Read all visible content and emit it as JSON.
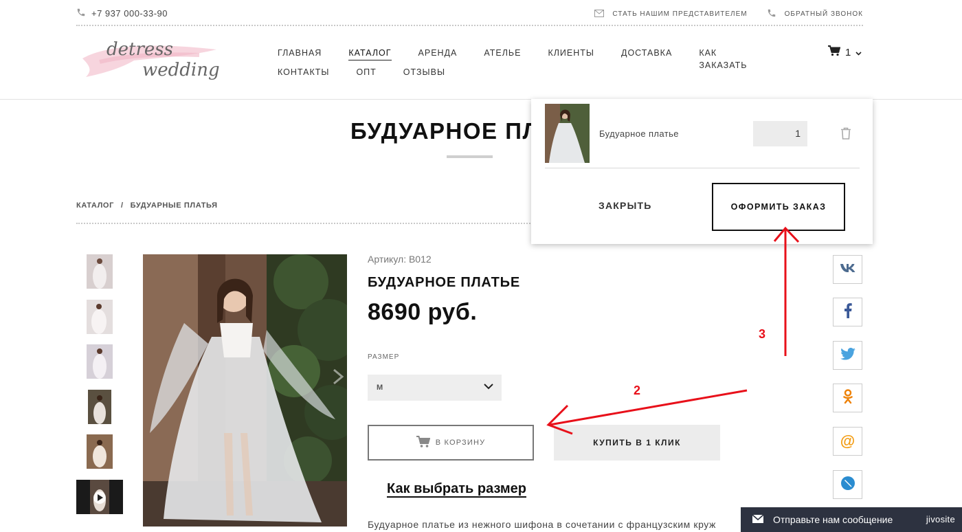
{
  "topbar": {
    "phone": "+7 937 000-33-90",
    "representative": "СТАТЬ НАШИМ ПРЕДСТАВИТЕЛЕМ",
    "callback": "ОБРАТНЫЙ ЗВОНОК"
  },
  "logo": {
    "line1": "detress",
    "line2": "wedding"
  },
  "nav": {
    "row1": [
      "ГЛАВНАЯ",
      "КАТАЛОГ",
      "АРЕНДА",
      "АТЕЛЬЕ",
      "КЛИЕНТЫ",
      "ДОСТАВКА",
      "КАК ЗАКАЗАТЬ"
    ],
    "row2": [
      "КОНТАКТЫ",
      "ОПТ",
      "ОТЗЫВЫ"
    ],
    "active": "КАТАЛОГ"
  },
  "cart": {
    "count": "1"
  },
  "page": {
    "title": "БУДУАРНОЕ ПЛА",
    "breadcrumb": [
      "КАТАЛОГ",
      "/",
      "БУДУАРНЫЕ ПЛАТЬЯ"
    ]
  },
  "product": {
    "sku": "Артикул: В012",
    "title": "БУДУАРНОЕ ПЛАТЬЕ",
    "price": "8690 руб.",
    "size_label": "РАЗМЕР",
    "size_value": "М",
    "add_to_cart": "В КОРЗИНУ",
    "buy_one_click": "КУПИТЬ В 1 КЛИК",
    "size_guide": "Как выбрать размер",
    "description": "Будуарное платье из нежного шифона в сочетании с французским круж"
  },
  "popup": {
    "item_name": "Будуарное платье",
    "qty": "1",
    "close": "ЗАКРЫТЬ",
    "checkout": "ОФОРМИТЬ ЗАКАЗ"
  },
  "annotations": {
    "step2": "2",
    "step3": "3"
  },
  "chat": {
    "label": "Отправьте нам сообщение",
    "brand": "jivosite"
  },
  "colors": {
    "annotation": "#e8101a",
    "logo_pink": "#f4c7d3",
    "chat_bg": "#2d3240"
  }
}
